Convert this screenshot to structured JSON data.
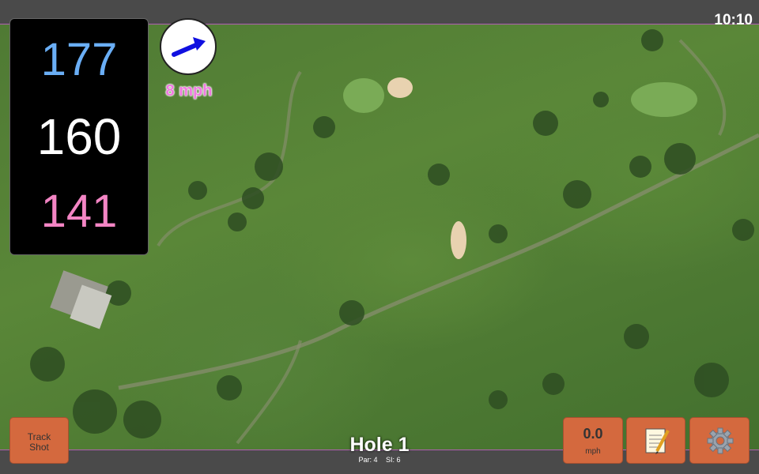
{
  "status": {
    "time": "10:10"
  },
  "yardages": {
    "back": "177",
    "middle": "160",
    "front": "141"
  },
  "wind": {
    "speed": "8 mph",
    "direction_icon": "arrow-icon",
    "arrow_color": "#1010e0"
  },
  "track_button": {
    "label_line1": "Track",
    "label_line2": "Shot"
  },
  "speed_button": {
    "value": "0.0",
    "unit": "mph"
  },
  "notes_button": {
    "icon": "notepad-icon"
  },
  "settings_button": {
    "icon": "gear-icon"
  },
  "hole": {
    "title": "Hole 1",
    "par": "Par: 4",
    "si": "SI: 6"
  },
  "colors": {
    "back": "#6aaef5",
    "middle": "#ffffff",
    "front": "#f385c4",
    "button": "#d4693e",
    "accent_border": "#b060b0"
  }
}
